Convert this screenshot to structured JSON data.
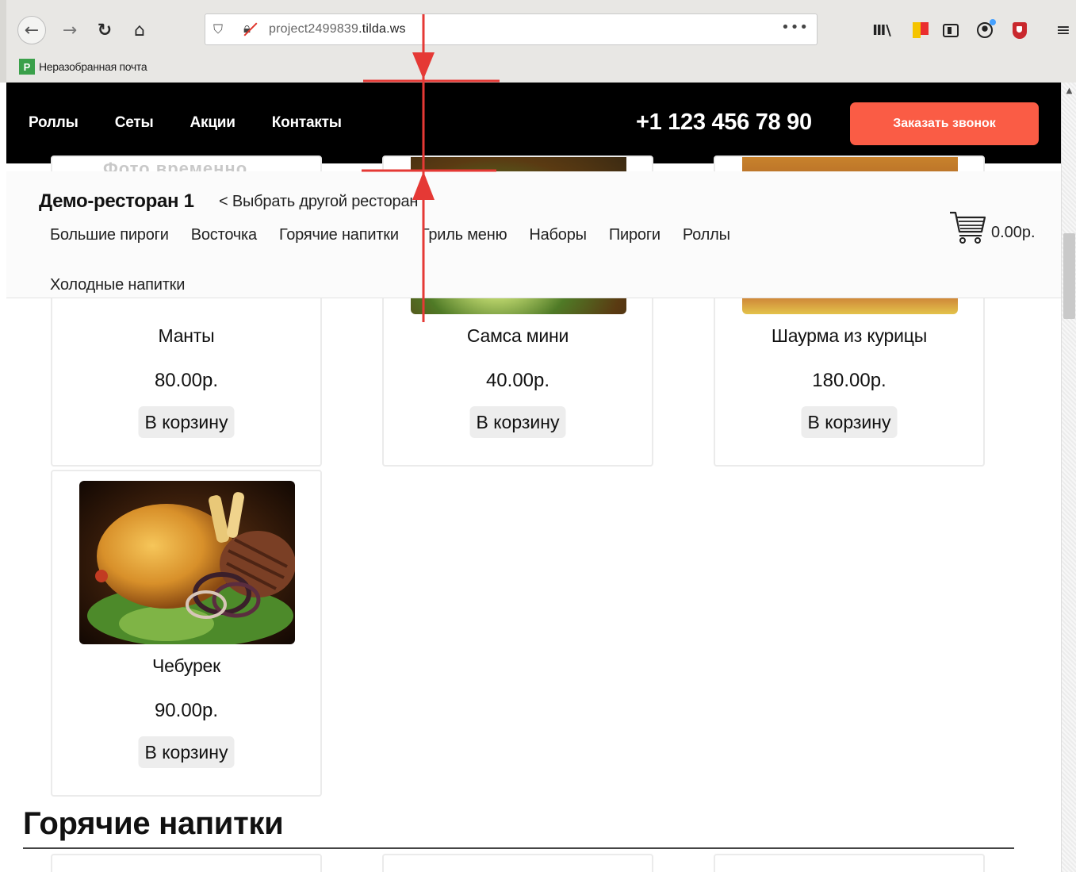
{
  "browser": {
    "url_host": "project2499839",
    "url_domain": ".tilda.ws",
    "url_more": "•••",
    "bookmark_label": "Неразобранная почта"
  },
  "header": {
    "nav": [
      "Роллы",
      "Сеты",
      "Акции",
      "Контакты"
    ],
    "phone": "+1 123 456 78 90",
    "call_button": "Заказать звонок"
  },
  "menu_bar": {
    "faded_text": "Фото временно",
    "restaurant_name": "Демо-ресторан 1",
    "change_restaurant": "< Выбрать другой ресторан",
    "categories": [
      "Большие пироги",
      "Восточка",
      "Горячие напитки",
      "Гриль меню",
      "Наборы",
      "Пироги",
      "Роллы",
      "Холодные напитки"
    ],
    "cart_total": "0.00р."
  },
  "products": [
    {
      "name": "Манты",
      "price": "80.00р.",
      "button": "В корзину"
    },
    {
      "name": "Самса мини",
      "price": "40.00р.",
      "button": "В корзину"
    },
    {
      "name": "Шаурма из курицы",
      "price": "180.00р.",
      "button": "В корзину"
    },
    {
      "name": "Чебурек",
      "price": "90.00р.",
      "button": "В корзину"
    }
  ],
  "section": {
    "title": "Горячие напитки"
  },
  "colors": {
    "header_bg": "#000000",
    "accent": "#fa5c45",
    "annotation": "#e53935"
  },
  "icons": {
    "back": "arrow-left-icon",
    "forward": "arrow-right-icon",
    "reload": "reload-icon",
    "home": "home-icon",
    "cart": "shopping-cart-icon"
  }
}
